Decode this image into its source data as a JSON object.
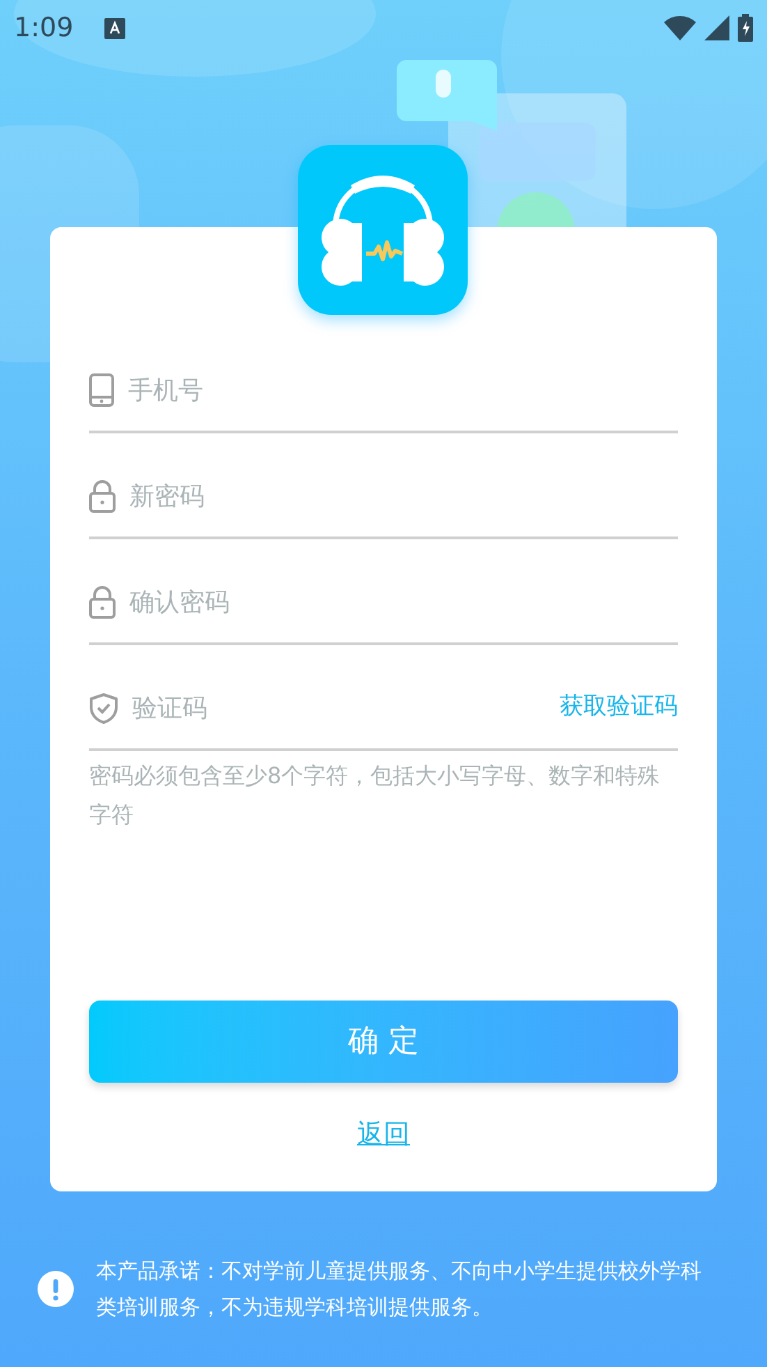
{
  "status_bar": {
    "time": "1:09"
  },
  "fields": [
    {
      "kind": "phone",
      "placeholder": "手机号"
    },
    {
      "kind": "password",
      "placeholder": "新密码"
    },
    {
      "kind": "password",
      "placeholder": "确认密码"
    },
    {
      "kind": "code",
      "placeholder": "验证码",
      "action": "获取验证码"
    }
  ],
  "hint": "密码必须包含至少8个字符，包括大小写字母、数字和特殊字符",
  "submit_button": "确 定",
  "back_link": "返回",
  "notice": "本产品承诺：不对学前儿童提供服务、不向中小学生提供校外学科类培训服务，不为违规学科培训提供服务。"
}
